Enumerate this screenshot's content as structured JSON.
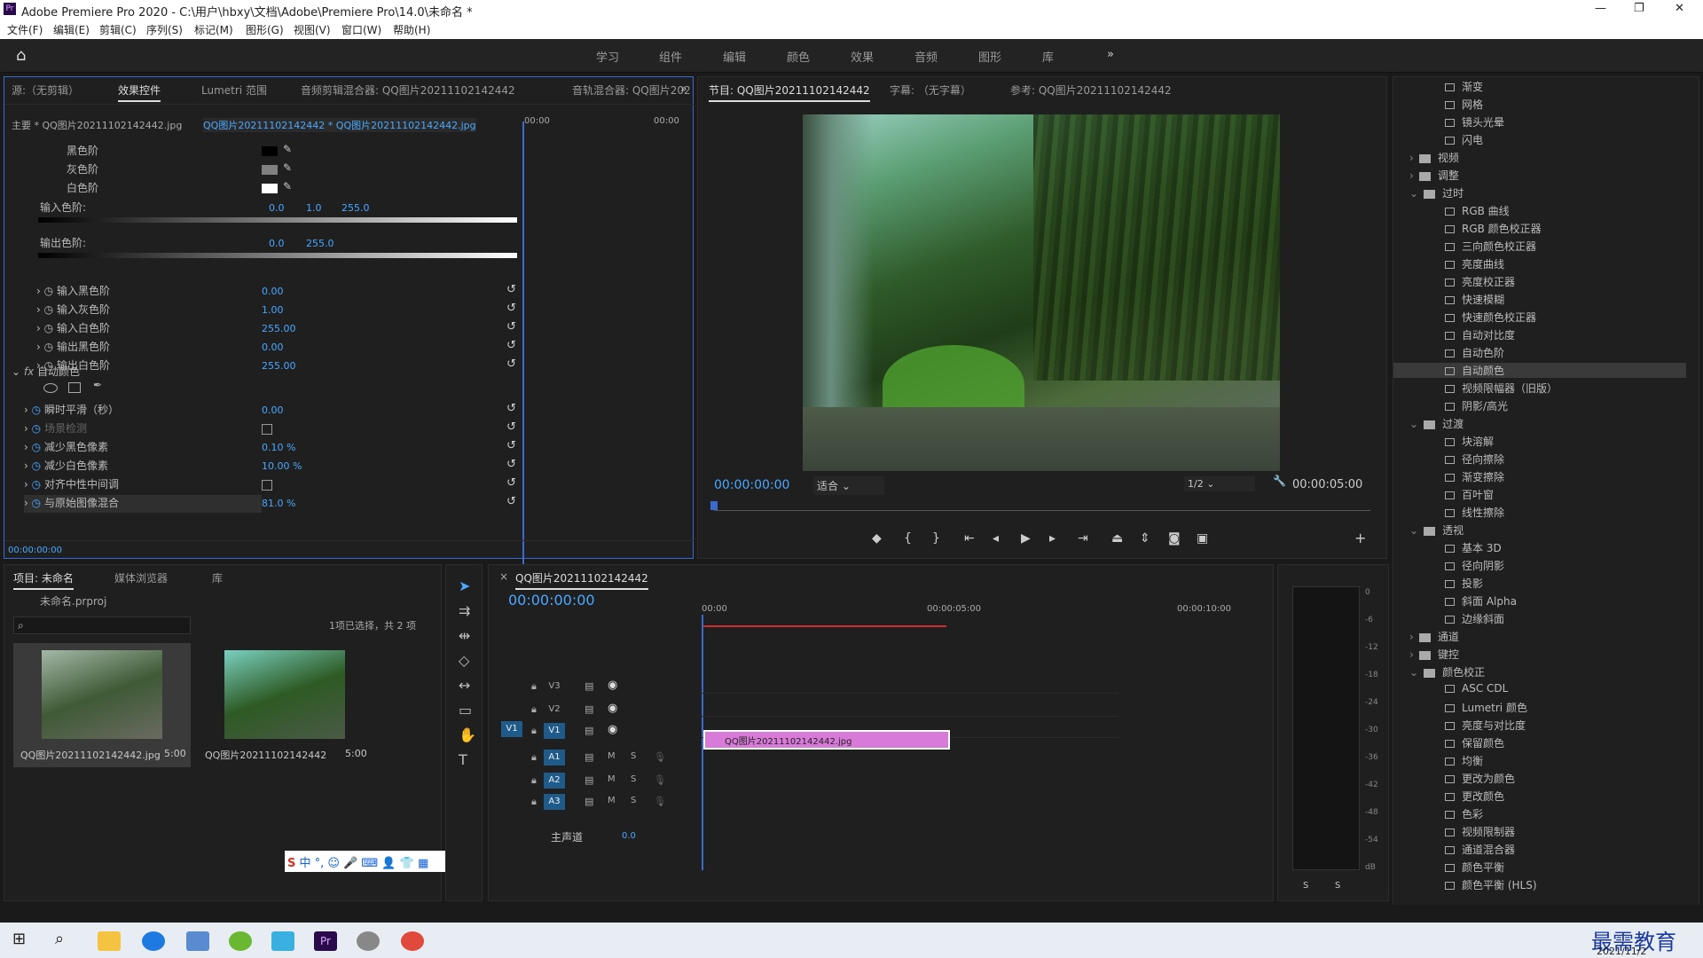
{
  "title_bar": {
    "app_title": "Adobe Premiere Pro 2020 - C:\\用户\\hbxy\\文档\\Adobe\\Premiere Pro\\14.0\\未命名 *",
    "minimize": "—",
    "maximize": "❐",
    "close": "✕"
  },
  "menu": [
    "文件(F)",
    "编辑(E)",
    "剪辑(C)",
    "序列(S)",
    "标记(M)",
    "图形(G)",
    "视图(V)",
    "窗口(W)",
    "帮助(H)"
  ],
  "workspaces": [
    "学习",
    "组件",
    "编辑",
    "颜色",
    "效果",
    "音频",
    "图形",
    "库"
  ],
  "source_panel": {
    "tabs": [
      "源:（无剪辑）",
      "效果控件",
      "Lumetri 范围",
      "音频剪辑混合器: QQ图片20211102142442",
      "音轨混合器: QQ图片202"
    ],
    "master": "主要 * QQ图片20211102142442.jpg",
    "clip": "QQ图片20211102142442 * QQ图片20211102142442.jpg",
    "mini_time_start": "00:00",
    "mini_time_end": "00:00",
    "levels": {
      "black": "黑色阶",
      "gray": "灰色阶",
      "white": "白色阶",
      "input_levels": "输入色阶:",
      "in_vals": [
        "0.0",
        "1.0",
        "255.0"
      ],
      "output_levels": "输出色阶:",
      "out_vals": [
        "0.0",
        "255.0"
      ]
    },
    "params": [
      {
        "label": "输入黑色阶",
        "value": "0.00"
      },
      {
        "label": "输入灰色阶",
        "value": "1.00"
      },
      {
        "label": "输入白色阶",
        "value": "255.00"
      },
      {
        "label": "输出黑色阶",
        "value": "0.00"
      },
      {
        "label": "输出白色阶",
        "value": "255.00"
      }
    ],
    "auto_color": "自动颜色",
    "ac_params": [
      {
        "label": "瞬时平滑（秒）",
        "value": "0.00"
      },
      {
        "label": "场景检测",
        "value": ""
      },
      {
        "label": "减少黑色像素",
        "value": "0.10 %"
      },
      {
        "label": "减少白色像素",
        "value": "10.00 %"
      },
      {
        "label": "对齐中性中间调",
        "value": ""
      },
      {
        "label": "与原始图像混合",
        "value": "81.0 %"
      }
    ],
    "timecode": "00:00:00:00"
  },
  "program": {
    "tabs": [
      "节目: QQ图片20211102142442",
      "字幕: （无字幕）",
      "参考: QQ图片20211102142442"
    ],
    "time": "00:00:00:00",
    "fit": "适合",
    "res": "1/2",
    "duration": "00:00:05:00"
  },
  "project": {
    "tabs": [
      "项目: 未命名",
      "媒体浏览器",
      "库"
    ],
    "file": "未命名.prproj",
    "selection": "1项已选择，共 2 项",
    "items": [
      {
        "name": "QQ图片20211102142442.jpg",
        "dur": "5:00"
      },
      {
        "name": "QQ图片20211102142442",
        "dur": "5:00"
      }
    ]
  },
  "timeline": {
    "tab": "QQ图片20211102142442",
    "time": "00:00:00:00",
    "ruler": [
      "00:00",
      "00:00:05:00",
      "00:00:10:00"
    ],
    "clip": "QQ图片20211102142442.jpg",
    "tracks_v": [
      "V3",
      "V2",
      "V1"
    ],
    "tracks_a": [
      "A1",
      "A2",
      "A3"
    ],
    "master": "主声道",
    "master_val": "0.0",
    "src_v": "V1",
    "mute": "M",
    "solo": "S"
  },
  "meter": {
    "ticks": [
      "0",
      "-6",
      "-12",
      "-18",
      "-24",
      "-30",
      "-36",
      "-42",
      "-48",
      "-54",
      "dB"
    ],
    "s": "S"
  },
  "effects": [
    {
      "t": "渐变",
      "f": false,
      "i": 1
    },
    {
      "t": "网格",
      "f": false,
      "i": 1
    },
    {
      "t": "镜头光晕",
      "f": false,
      "i": 1
    },
    {
      "t": "闪电",
      "f": false,
      "i": 1
    },
    {
      "t": "视频",
      "f": true,
      "i": 0
    },
    {
      "t": "调整",
      "f": true,
      "i": 0
    },
    {
      "t": "过时",
      "f": true,
      "i": 0,
      "open": true
    },
    {
      "t": "RGB 曲线",
      "f": false,
      "i": 1
    },
    {
      "t": "RGB 颜色校正器",
      "f": false,
      "i": 1
    },
    {
      "t": "三向颜色校正器",
      "f": false,
      "i": 1
    },
    {
      "t": "亮度曲线",
      "f": false,
      "i": 1
    },
    {
      "t": "亮度校正器",
      "f": false,
      "i": 1
    },
    {
      "t": "快速模糊",
      "f": false,
      "i": 1
    },
    {
      "t": "快速颜色校正器",
      "f": false,
      "i": 1
    },
    {
      "t": "自动对比度",
      "f": false,
      "i": 1
    },
    {
      "t": "自动色阶",
      "f": false,
      "i": 1
    },
    {
      "t": "自动颜色",
      "f": false,
      "i": 1,
      "sel": true
    },
    {
      "t": "视频限幅器（旧版）",
      "f": false,
      "i": 1
    },
    {
      "t": "阴影/高光",
      "f": false,
      "i": 1
    },
    {
      "t": "过渡",
      "f": true,
      "i": 0,
      "open": true
    },
    {
      "t": "块溶解",
      "f": false,
      "i": 1
    },
    {
      "t": "径向擦除",
      "f": false,
      "i": 1
    },
    {
      "t": "渐变擦除",
      "f": false,
      "i": 1
    },
    {
      "t": "百叶窗",
      "f": false,
      "i": 1
    },
    {
      "t": "线性擦除",
      "f": false,
      "i": 1
    },
    {
      "t": "透视",
      "f": true,
      "i": 0,
      "open": true
    },
    {
      "t": "基本 3D",
      "f": false,
      "i": 1
    },
    {
      "t": "径向阴影",
      "f": false,
      "i": 1
    },
    {
      "t": "投影",
      "f": false,
      "i": 1
    },
    {
      "t": "斜面 Alpha",
      "f": false,
      "i": 1
    },
    {
      "t": "边缘斜面",
      "f": false,
      "i": 1
    },
    {
      "t": "通道",
      "f": true,
      "i": 0
    },
    {
      "t": "键控",
      "f": true,
      "i": 0
    },
    {
      "t": "颜色校正",
      "f": true,
      "i": 0,
      "open": true
    },
    {
      "t": "ASC CDL",
      "f": false,
      "i": 1
    },
    {
      "t": "Lumetri 颜色",
      "f": false,
      "i": 1
    },
    {
      "t": "亮度与对比度",
      "f": false,
      "i": 1
    },
    {
      "t": "保留颜色",
      "f": false,
      "i": 1
    },
    {
      "t": "均衡",
      "f": false,
      "i": 1
    },
    {
      "t": "更改为颜色",
      "f": false,
      "i": 1
    },
    {
      "t": "更改颜色",
      "f": false,
      "i": 1
    },
    {
      "t": "色彩",
      "f": false,
      "i": 1
    },
    {
      "t": "视频限制器",
      "f": false,
      "i": 1
    },
    {
      "t": "通道混合器",
      "f": false,
      "i": 1
    },
    {
      "t": "颜色平衡",
      "f": false,
      "i": 1
    },
    {
      "t": "颜色平衡 (HLS)",
      "f": false,
      "i": 1
    }
  ],
  "ime": "中 °, ☺ 🎤 ⌨ 👤 👕 ▦",
  "taskbar": {
    "clock": "2021/11/2",
    "watermark": "最需教育"
  }
}
